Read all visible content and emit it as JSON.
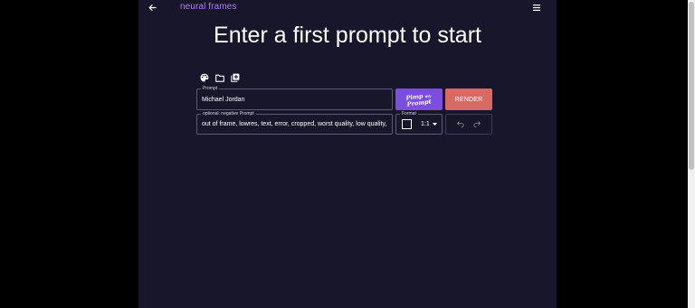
{
  "header": {
    "brand": "neural frames"
  },
  "page": {
    "headline": "Enter a first prompt to start"
  },
  "prompt": {
    "label": "Prompt",
    "value": "Michael Jordan"
  },
  "negative_prompt": {
    "label": "optional: negative Prompt",
    "value": "out of frame, lowres, text, error, cropped, worst quality, low quality,"
  },
  "pimp_button": {
    "line1": "Pimp",
    "line2": "my",
    "line3": "Prompt"
  },
  "render_button": {
    "label": "RENDER"
  },
  "format": {
    "label": "Format",
    "selected": "1:1"
  },
  "colors": {
    "background": "#17162b",
    "brand": "#b47cf5",
    "pimp": "#7c4ee0",
    "render": "#d96a63"
  },
  "icons": {
    "back": "arrow-left-icon",
    "menu": "hamburger-menu-icon",
    "tools": [
      "palette-icon",
      "folder-icon",
      "add-library-icon"
    ],
    "history": [
      "undo-icon",
      "redo-icon"
    ]
  }
}
